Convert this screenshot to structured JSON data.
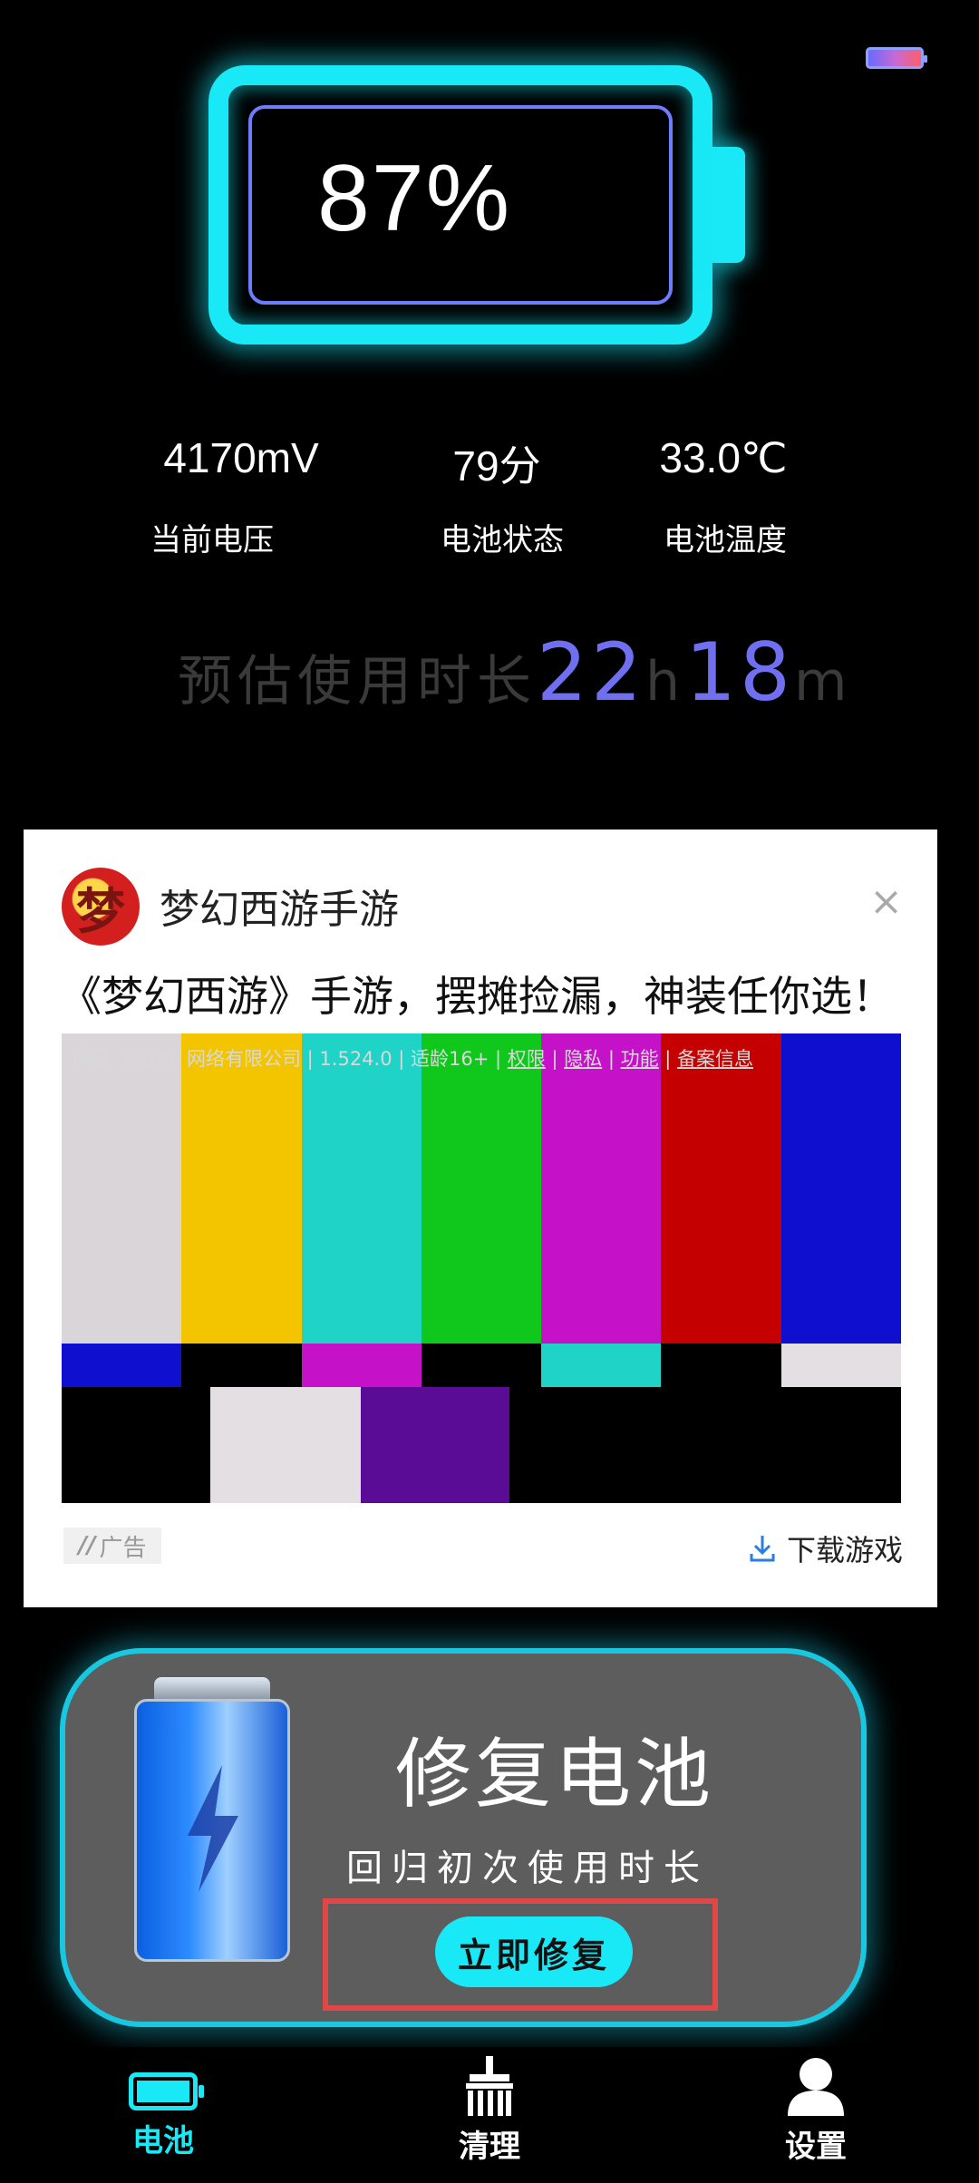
{
  "battery": {
    "percent": "87%",
    "level": 0.87
  },
  "stats": [
    {
      "value": "4170mV",
      "label": "当前电压"
    },
    {
      "value": "79分",
      "label": "电池状态"
    },
    {
      "value": "33.0℃",
      "label": "电池温度"
    }
  ],
  "usage": {
    "label": "预估使用时长",
    "hours": "22",
    "h_unit": "h",
    "minutes": "18",
    "m_unit": "m"
  },
  "ad": {
    "logo_char": "梦",
    "app_name": "梦幻西游手游",
    "close_glyph": "×",
    "description": "《梦幻西游》手游，摆摊捡漏，神装任你选！",
    "meta_company": "网易（杭州）网络有限公司 | 1.524.0 | 适龄16+ | ",
    "meta_permissions": "权限",
    "meta_privacy": "隐私",
    "meta_function": "功能",
    "meta_filing": "备案信息",
    "badge": "广告",
    "download_label": "下载游戏"
  },
  "repair": {
    "title": "修复电池",
    "subtitle": "回归初次使用时长",
    "button_label": "立即修复"
  },
  "nav": [
    {
      "label": "电池",
      "icon": "battery-icon",
      "active": true
    },
    {
      "label": "清理",
      "icon": "broom-icon",
      "active": false
    },
    {
      "label": "设置",
      "icon": "user-icon",
      "active": false
    }
  ],
  "colors": {
    "accent": "#19e8f6",
    "usage_number": "#6f6ff0",
    "highlight": "#e04848"
  }
}
